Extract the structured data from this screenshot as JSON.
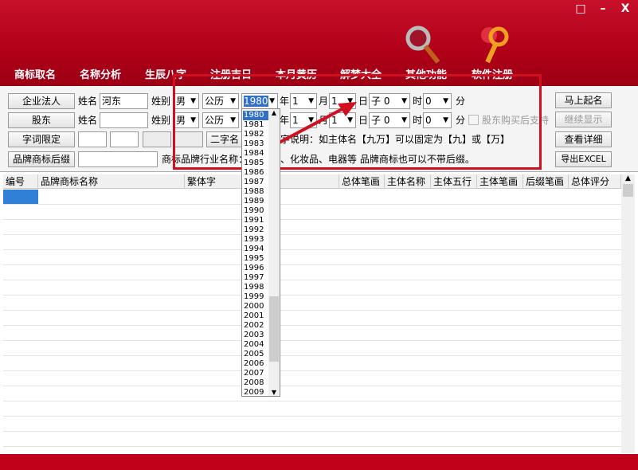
{
  "window": {
    "menu_icon": "□",
    "minimize": "–",
    "close": "X"
  },
  "menu": [
    "商标取名",
    "名称分析",
    "生辰八字",
    "注册吉日",
    "本月黄历",
    "解梦大全",
    "其他功能",
    "软件注册"
  ],
  "row1": {
    "role": "企业法人",
    "name_label": "姓名",
    "name_value": "河东",
    "gender_label": "姓别",
    "gender": "男",
    "calendar": "公历",
    "year": "1980",
    "year_label": "年",
    "month": "1",
    "month_label": "月",
    "day": "1",
    "day_label": "日",
    "hour": "子 0",
    "hour_label": "时",
    "minute": "0",
    "minute_label": "分"
  },
  "row2": {
    "role": "股东",
    "name_label": "姓名",
    "name_value": "",
    "gender_label": "姓别",
    "gender": "男",
    "calendar": "公历",
    "year_label": "年",
    "month": "1",
    "month_label": "月",
    "day": "1",
    "day_label": "日",
    "hour": "子 0",
    "hour_label": "时",
    "minute": "0",
    "minute_label": "分",
    "checkbox_label": "股东购买后支持"
  },
  "row3": {
    "button": "字词限定",
    "name_type": "二字名",
    "note": "字说明：如主体名【九万】可以固定为【九】或【万】"
  },
  "row4": {
    "button": "品牌商标后缀",
    "industry_label": "商标品牌行业名称：",
    "note": "、化妆品、电器等 品牌商标也可以不带后缀。"
  },
  "actions": {
    "generate": "马上起名",
    "continue": "继续显示",
    "details": "查看详细",
    "export": "导出EXCEL"
  },
  "table": {
    "columns": [
      "编号",
      "品牌商标名称",
      "繁体字",
      "总体笔画",
      "主体名称",
      "主体五行",
      "主体笔画",
      "后缀笔画",
      "总体评分"
    ]
  },
  "year_dropdown": {
    "selected": "1980",
    "options": [
      "1980",
      "1981",
      "1982",
      "1983",
      "1984",
      "1985",
      "1986",
      "1987",
      "1988",
      "1989",
      "1990",
      "1991",
      "1992",
      "1993",
      "1994",
      "1995",
      "1996",
      "1997",
      "1998",
      "1999",
      "2000",
      "2001",
      "2002",
      "2003",
      "2004",
      "2005",
      "2006",
      "2007",
      "2008",
      "2009"
    ]
  }
}
